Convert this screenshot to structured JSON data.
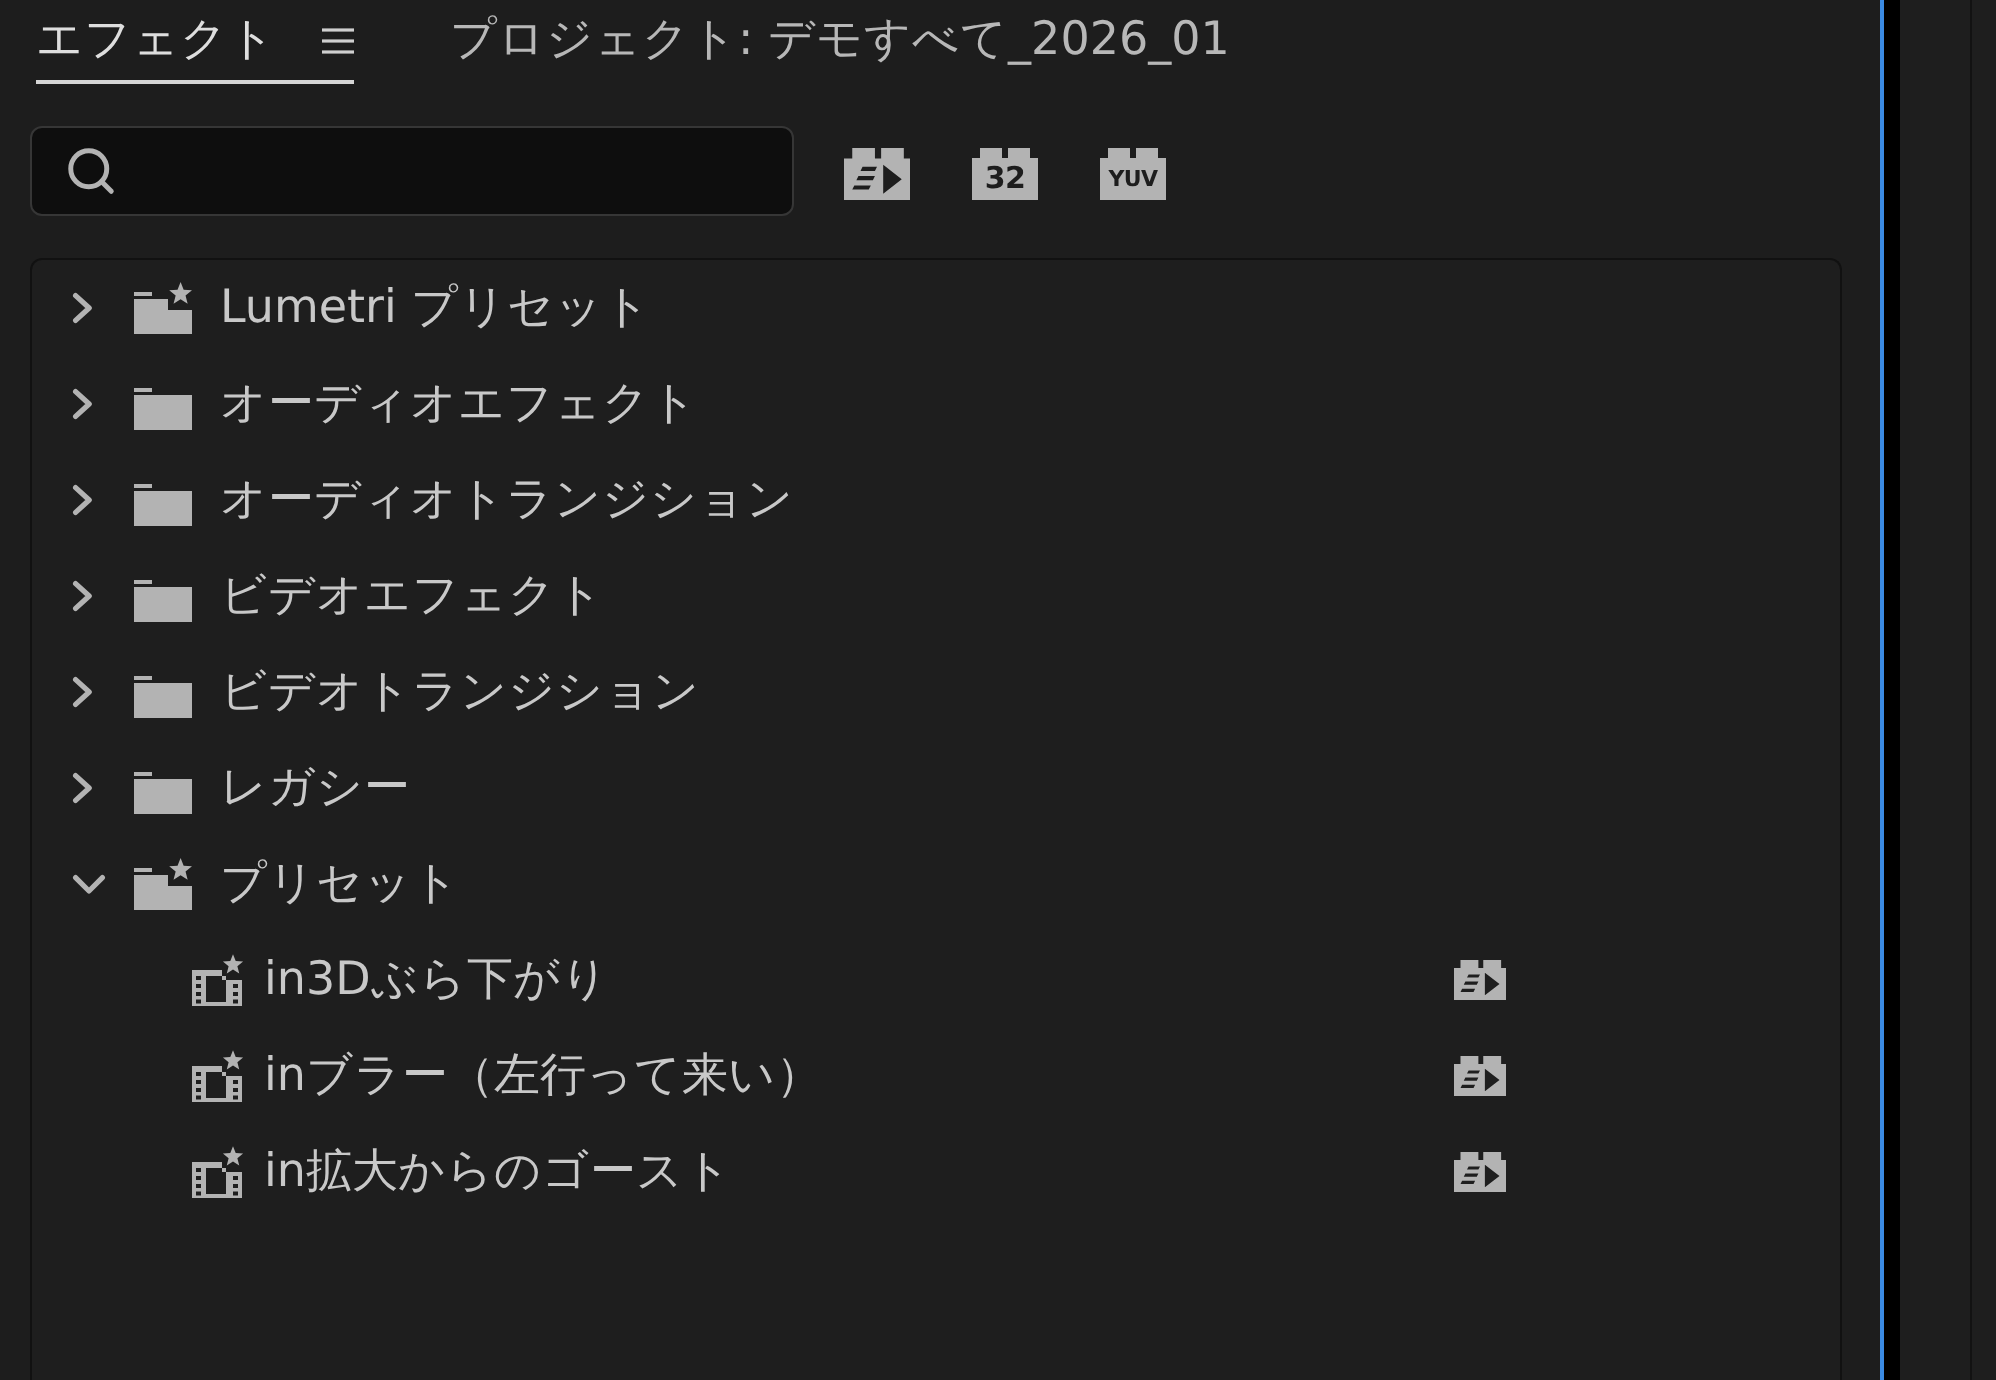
{
  "tabs": [
    {
      "label": "エフェクト",
      "selected": true
    },
    {
      "label": "プロジェクト: デモすべて_2026_01",
      "selected": false
    }
  ],
  "filters": [
    {
      "kind": "accelerated",
      "selected": false
    },
    {
      "kind": "bit32",
      "label": "32",
      "selected": false
    },
    {
      "kind": "yuv",
      "label": "YUV",
      "selected": false
    }
  ],
  "tree": [
    {
      "label": "Lumetri プリセット",
      "kind": "preset_folder",
      "expanded": false
    },
    {
      "label": "オーディオエフェクト",
      "kind": "folder",
      "expanded": false
    },
    {
      "label": "オーディオトランジション",
      "kind": "folder",
      "expanded": false
    },
    {
      "label": "ビデオエフェクト",
      "kind": "folder",
      "expanded": false
    },
    {
      "label": "ビデオトランジション",
      "kind": "folder",
      "expanded": false
    },
    {
      "label": "レガシー",
      "kind": "folder",
      "expanded": false
    },
    {
      "label": "プリセット",
      "kind": "preset_folder",
      "expanded": true,
      "children": [
        {
          "label": "in3Dぶら下がり",
          "accelerated": true
        },
        {
          "label": "inブラー（左行って来い）",
          "accelerated": true
        },
        {
          "label": "in拡大からのゴースト",
          "accelerated": true
        }
      ]
    }
  ]
}
